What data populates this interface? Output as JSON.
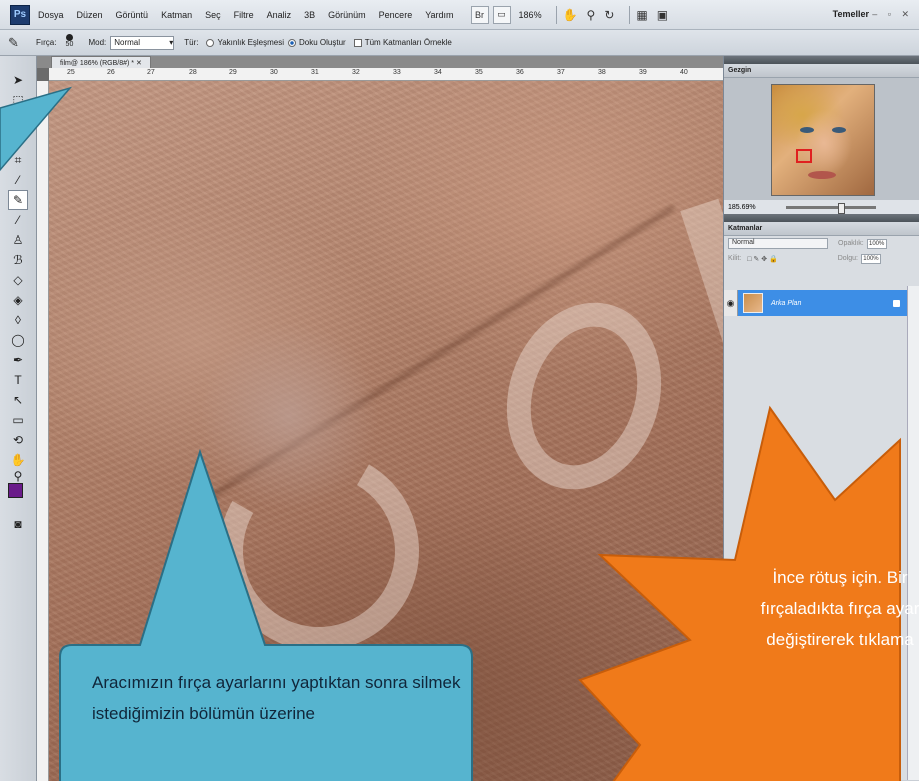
{
  "menubar": {
    "logo": "Ps",
    "items": [
      "Dosya",
      "Düzen",
      "Görüntü",
      "Katman",
      "Seç",
      "Filtre",
      "Analiz",
      "3B",
      "Görünüm",
      "Pencere",
      "Yardım"
    ],
    "br_label": "Br",
    "zoom": "186%",
    "workspace": "Temeller",
    "window_controls": "– ▫ ✕"
  },
  "options": {
    "brush_label": "Fırça:",
    "brush_size": "50",
    "mode_label": "Mod:",
    "mode_value": "Normal",
    "type_label": "Tür:",
    "radio1": "Yakınlık Eşleşmesi",
    "radio2": "Doku Oluştur",
    "sample_all": "Tüm Katmanları Örnekle"
  },
  "document": {
    "tab_title": "film@ 186% (RGB/8#) * ✕",
    "ruler_numbers": [
      "25",
      "26",
      "27",
      "28",
      "29",
      "30",
      "31",
      "32",
      "33",
      "34",
      "35",
      "36",
      "37",
      "38",
      "39",
      "40"
    ]
  },
  "navigator": {
    "title": "Gezgin",
    "zoom": "185.69%"
  },
  "layers": {
    "title": "Katmanlar",
    "blend_mode": "Normal",
    "opacity_label": "Opaklık:",
    "opacity": "100%",
    "lock_label": "Kilit:",
    "fill_label": "Dolgu:",
    "fill": "100%",
    "layer_name": "Arka Plan"
  },
  "callouts": {
    "blue_text": "Aracımızın fırça ayarlarını yaptıktan sonra silmek istediğimizin bölümün üzerine",
    "orange_text": "İnce rötuş için. Bir fırçaladıkta fırça ayar değiştirerek tıklama",
    "blue_color": "#56b4cf",
    "orange_color": "#f07a1a"
  },
  "colors": {
    "foreground": "#6a1b8a",
    "background": "#ffffff",
    "selection": "#3d8ee6"
  }
}
